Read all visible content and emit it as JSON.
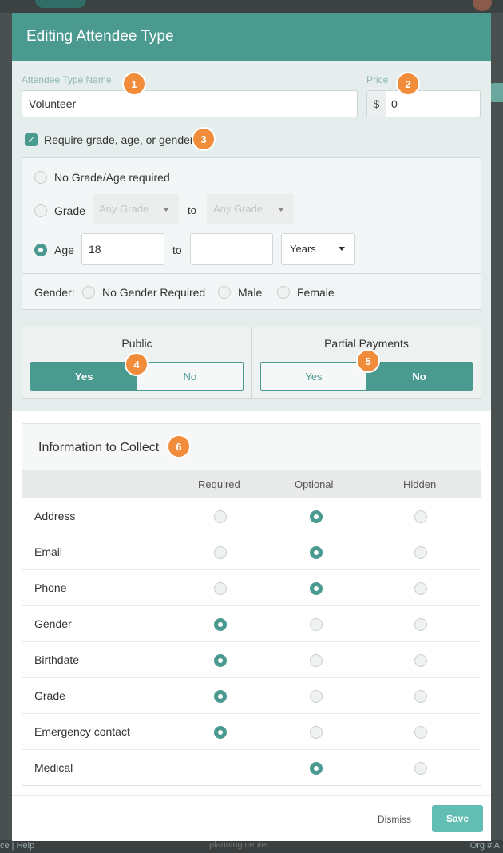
{
  "background": {
    "footer_left": "ce | Help",
    "footer_center": "planning center",
    "footer_right": "Org # A"
  },
  "modal": {
    "title": "Editing Attendee Type",
    "name_label": "Attendee Type Name",
    "name_value": "Volunteer",
    "price_label": "Price",
    "price_prefix": "$",
    "price_value": "0",
    "require_checkbox_label": "Require grade, age, or gender",
    "require_checked": true
  },
  "requirements": {
    "no_grade_label": "No Grade/Age required",
    "grade_label": "Grade",
    "grade_from": "Any Grade",
    "grade_to": "Any Grade",
    "to_label": "to",
    "age_label": "Age",
    "age_from": "18",
    "age_to": "",
    "age_unit": "Years",
    "selected": "age",
    "gender_label": "Gender:",
    "gender_options": [
      "No Gender Required",
      "Male",
      "Female"
    ]
  },
  "public": {
    "title": "Public",
    "yes": "Yes",
    "no": "No",
    "selected": "Yes"
  },
  "partial_payments": {
    "title": "Partial Payments",
    "yes": "Yes",
    "no": "No",
    "selected": "No"
  },
  "info": {
    "title": "Information to Collect",
    "columns": [
      "Required",
      "Optional",
      "Hidden"
    ],
    "rows": [
      {
        "name": "Address",
        "selected": "Optional"
      },
      {
        "name": "Email",
        "selected": "Optional"
      },
      {
        "name": "Phone",
        "selected": "Optional"
      },
      {
        "name": "Gender",
        "selected": "Required"
      },
      {
        "name": "Birthdate",
        "selected": "Required"
      },
      {
        "name": "Grade",
        "selected": "Required"
      },
      {
        "name": "Emergency contact",
        "selected": "Required"
      },
      {
        "name": "Medical",
        "selected": "Optional"
      }
    ]
  },
  "badges": [
    "1",
    "2",
    "3",
    "4",
    "5",
    "6"
  ],
  "footer": {
    "dismiss": "Dismiss",
    "save": "Save"
  },
  "colors": {
    "accent": "#4a9a90",
    "badge": "#f08c3a",
    "save": "#62bdb2"
  }
}
